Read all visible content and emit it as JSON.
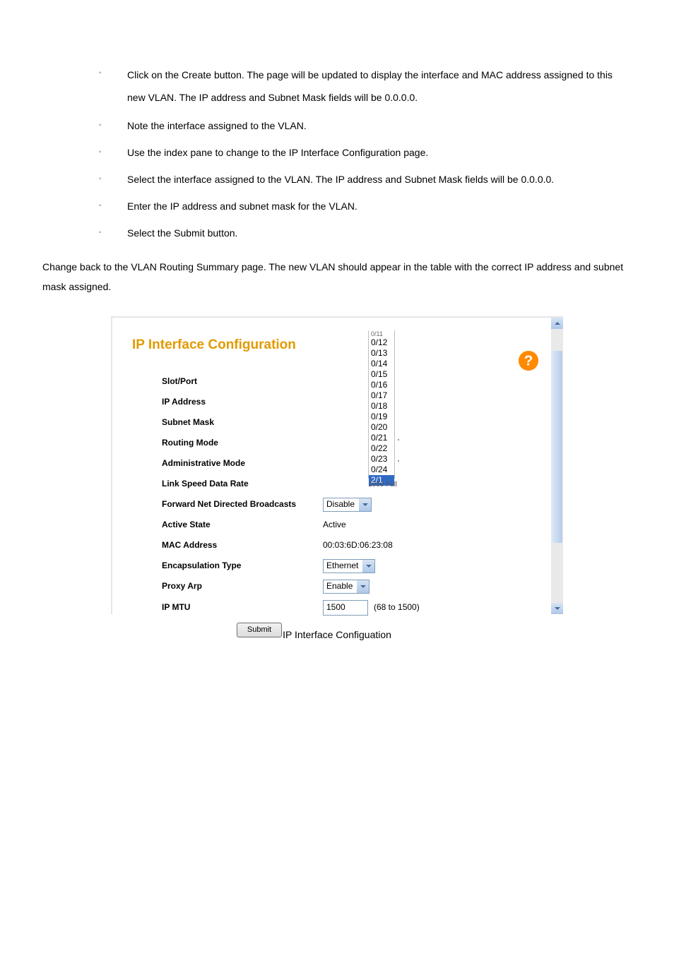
{
  "instructions": {
    "items": [
      "Click on the Create button. The page will be updated to display the interface and MAC address assigned to this new VLAN. The IP address and Subnet Mask fields will be 0.0.0.0.",
      "Note the interface assigned to the VLAN.",
      "Use the index pane to change to the IP Interface Configuration page.",
      "Select the interface assigned to the VLAN. The IP address and Subnet Mask fields will be 0.0.0.0.",
      "Enter the IP address and subnet mask for the VLAN.",
      "Select the Submit button."
    ]
  },
  "paragraph": "Change back to the VLAN Routing Summary page. The new VLAN should appear in the table with the correct IP address and subnet mask assigned.",
  "figure": {
    "title": "IP Interface Configuration",
    "caption": "IP Interface Configuation",
    "submit_label": "Submit",
    "slotport": {
      "label": "Slot/Port",
      "options": [
        "0/12",
        "0/13",
        "0/14",
        "0/15",
        "0/16",
        "0/17",
        "0/18",
        "0/19",
        "0/20",
        "0/21",
        "0/22",
        "0/23",
        "0/24",
        "2/1"
      ],
      "selected": "2/1",
      "suffix_fragment": "1000 Full"
    },
    "rows": {
      "ip_address": {
        "label": "IP Address"
      },
      "subnet_mask": {
        "label": "Subnet Mask"
      },
      "routing_mode": {
        "label": "Routing Mode"
      },
      "admin_mode": {
        "label": "Administrative Mode"
      },
      "link_speed": {
        "label": "Link Speed Data Rate"
      },
      "fwd_broadcast": {
        "label": "Forward Net Directed Broadcasts",
        "value": "Disable"
      },
      "active_state": {
        "label": "Active State",
        "value": "Active"
      },
      "mac_address": {
        "label": "MAC Address",
        "value": "00:03:6D:06:23:08"
      },
      "encap_type": {
        "label": "Encapsulation Type",
        "value": "Ethernet"
      },
      "proxy_arp": {
        "label": "Proxy Arp",
        "value": "Enable"
      },
      "ip_mtu": {
        "label": "IP MTU",
        "value": "1500",
        "hint": "(68 to 1500)"
      }
    }
  }
}
